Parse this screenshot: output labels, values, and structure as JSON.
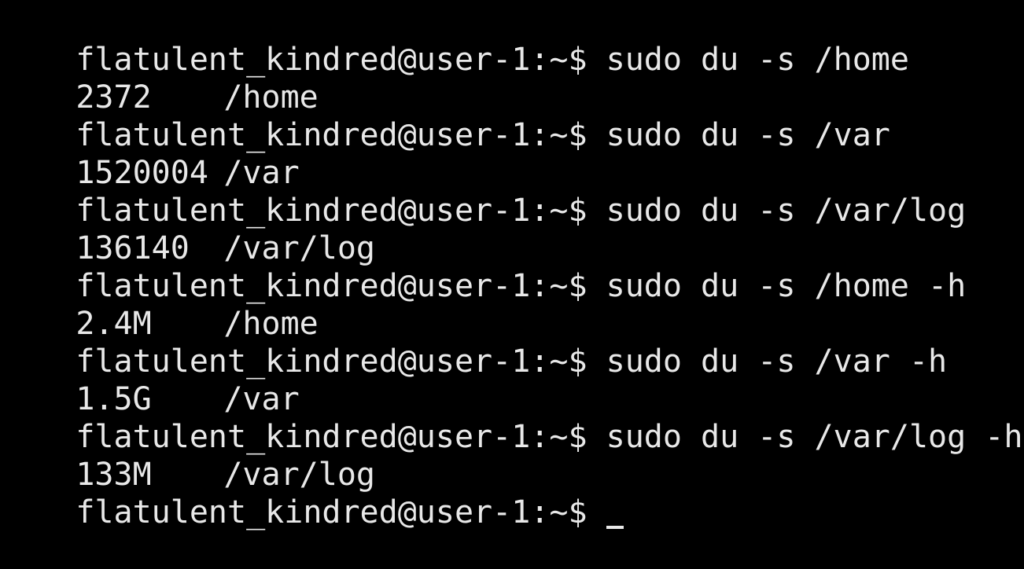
{
  "terminal": {
    "prompt": "flatulent_kindred@user-1:~$ ",
    "entries": [
      {
        "command": "sudo du -s /home",
        "size": "2372",
        "path": "/home"
      },
      {
        "command": "sudo du -s /var",
        "size": "1520004",
        "path": "/var"
      },
      {
        "command": "sudo du -s /var/log",
        "size": "136140",
        "path": "/var/log"
      },
      {
        "command": "sudo du -s /home -h",
        "size": "2.4M",
        "path": "/home"
      },
      {
        "command": "sudo du -s /var -h",
        "size": "1.5G",
        "path": "/var"
      },
      {
        "command": "sudo du -s /var/log -h",
        "size": "133M",
        "path": "/var/log"
      }
    ],
    "foreground_color": "#e8e8e8",
    "background_color": "#000000"
  }
}
